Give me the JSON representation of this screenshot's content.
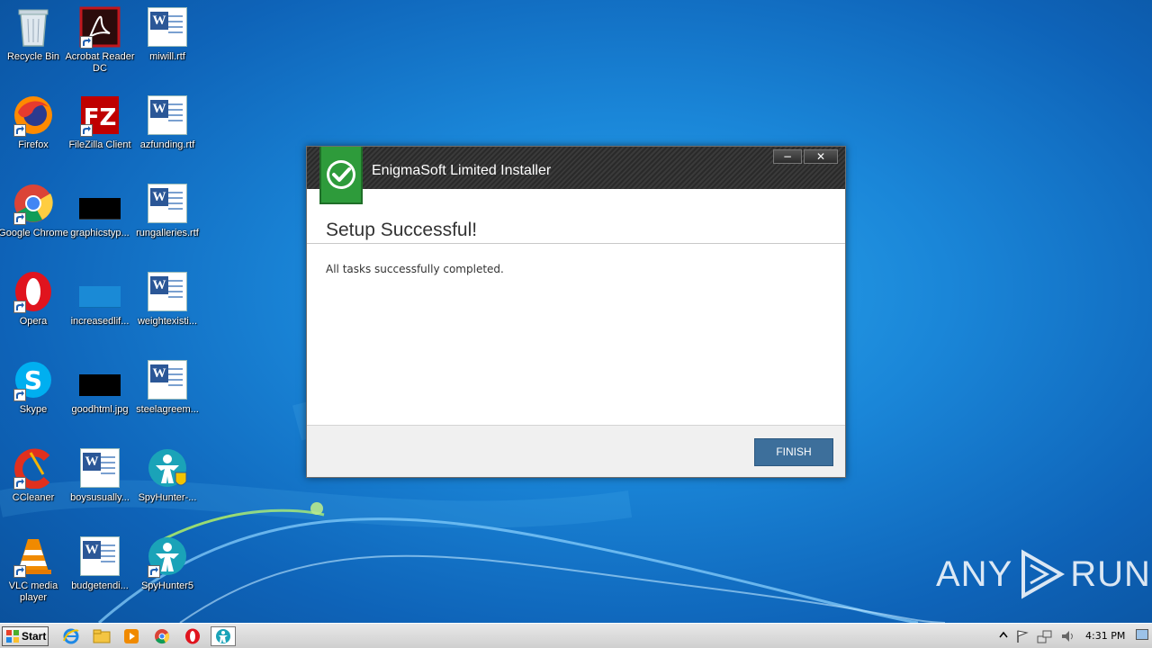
{
  "desktop": {
    "icons": [
      {
        "label": "Recycle Bin"
      },
      {
        "label": "Acrobat Reader DC"
      },
      {
        "label": "miwill.rtf"
      },
      {
        "label": "Firefox"
      },
      {
        "label": "FileZilla Client"
      },
      {
        "label": "azfunding.rtf"
      },
      {
        "label": "Google Chrome"
      },
      {
        "label": "graphicstyp..."
      },
      {
        "label": "rungalleries.rtf"
      },
      {
        "label": "Opera"
      },
      {
        "label": "increasedlif..."
      },
      {
        "label": "weightexisti..."
      },
      {
        "label": "Skype"
      },
      {
        "label": "goodhtml.jpg"
      },
      {
        "label": "steelagreem..."
      },
      {
        "label": "CCleaner"
      },
      {
        "label": "boysusually..."
      },
      {
        "label": "SpyHunter-..."
      },
      {
        "label": "VLC media player"
      },
      {
        "label": "budgetendi..."
      },
      {
        "label": "SpyHunter5"
      }
    ]
  },
  "installer": {
    "title": "EnigmaSoft Limited Installer",
    "minimize_glyph": "−",
    "close_glyph": "✕",
    "heading": "Setup Successful!",
    "message": "All tasks successfully completed.",
    "finish_label": "FINISH",
    "accent": "#3d6f9b"
  },
  "watermark": {
    "left": "ANY",
    "right": "RUN"
  },
  "taskbar": {
    "start_label": "Start",
    "pinned": [
      {
        "icon": "internet-explorer-icon"
      },
      {
        "icon": "file-explorer-icon"
      },
      {
        "icon": "media-player-icon"
      },
      {
        "icon": "chrome-icon"
      },
      {
        "icon": "opera-icon"
      },
      {
        "icon": "installer-icon"
      }
    ],
    "clock": "4:31 PM"
  }
}
